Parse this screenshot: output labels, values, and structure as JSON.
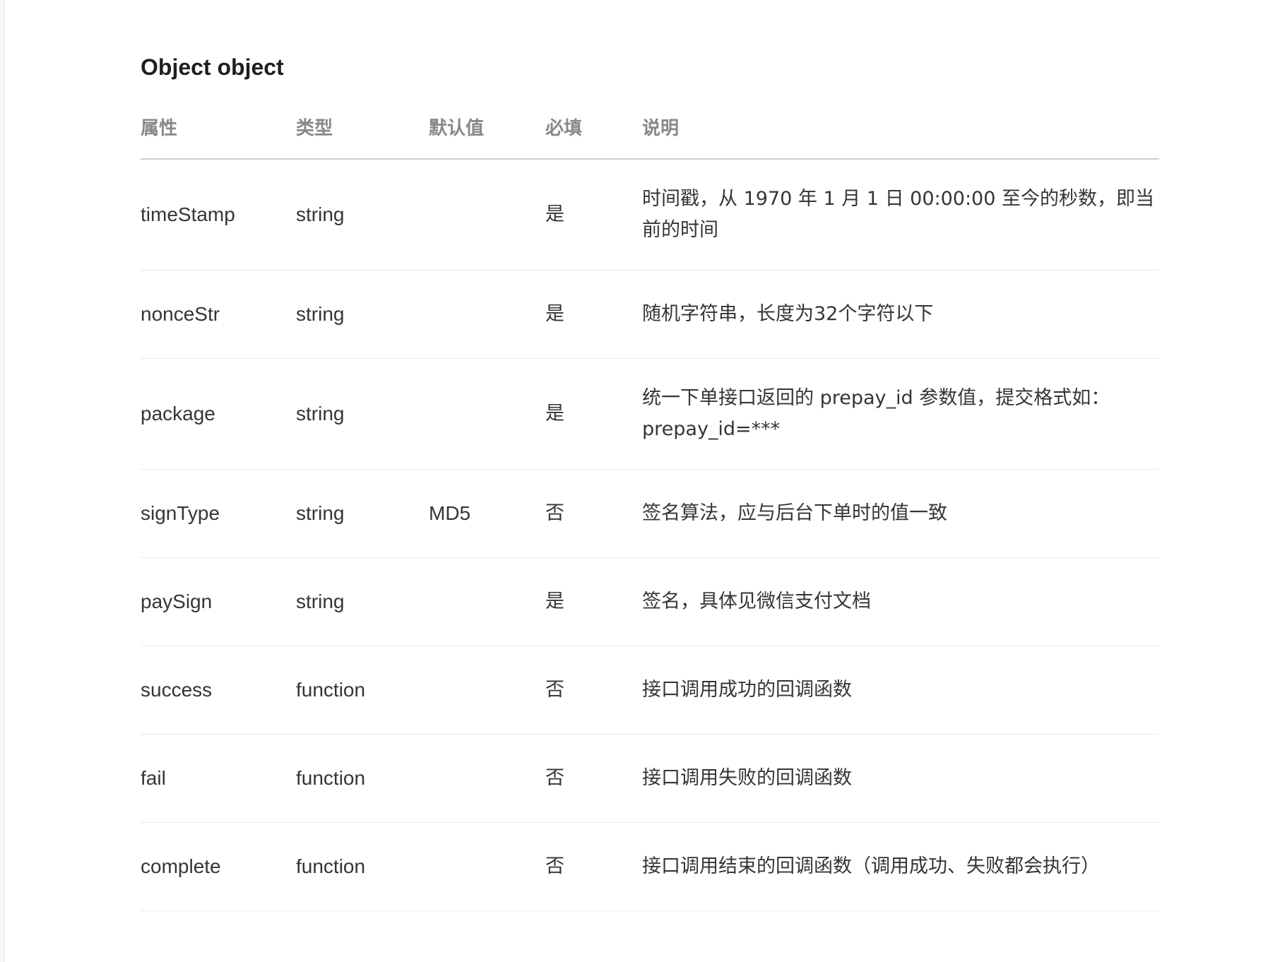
{
  "section": {
    "title": "Object object"
  },
  "table": {
    "headers": {
      "property": "属性",
      "type": "类型",
      "default": "默认值",
      "required": "必填",
      "description": "说明"
    },
    "rows": [
      {
        "property": "timeStamp",
        "type": "string",
        "default": "",
        "required": "是",
        "description": "时间戳，从 1970 年 1 月 1 日 00:00:00 至今的秒数，即当前的时间"
      },
      {
        "property": "nonceStr",
        "type": "string",
        "default": "",
        "required": "是",
        "description": "随机字符串，长度为32个字符以下"
      },
      {
        "property": "package",
        "type": "string",
        "default": "",
        "required": "是",
        "description": "统一下单接口返回的 prepay_id 参数值，提交格式如：prepay_id=***"
      },
      {
        "property": "signType",
        "type": "string",
        "default": "MD5",
        "required": "否",
        "description": "签名算法，应与后台下单时的值一致"
      },
      {
        "property": "paySign",
        "type": "string",
        "default": "",
        "required": "是",
        "description": "签名，具体见微信支付文档"
      },
      {
        "property": "success",
        "type": "function",
        "default": "",
        "required": "否",
        "description": "接口调用成功的回调函数"
      },
      {
        "property": "fail",
        "type": "function",
        "default": "",
        "required": "否",
        "description": "接口调用失败的回调函数"
      },
      {
        "property": "complete",
        "type": "function",
        "default": "",
        "required": "否",
        "description": "接口调用结束的回调函数（调用成功、失败都会执行）"
      }
    ]
  }
}
